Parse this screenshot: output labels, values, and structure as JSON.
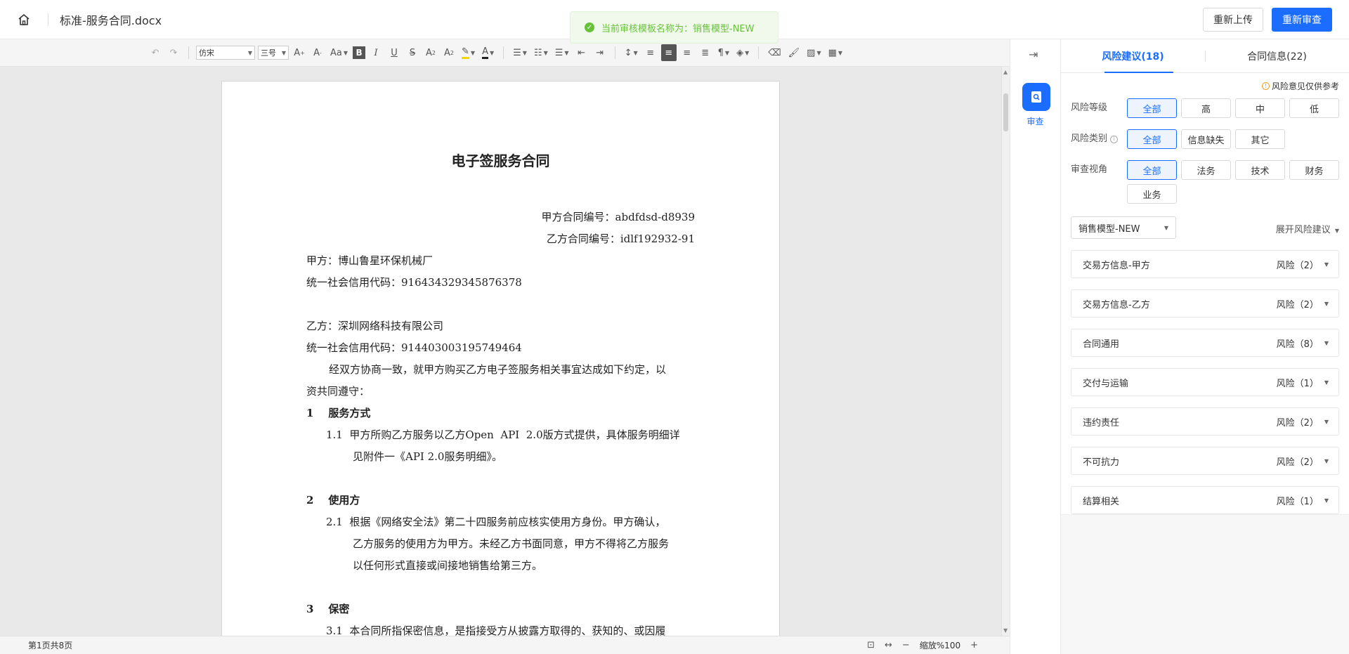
{
  "header": {
    "title": "标准-服务合同.docx",
    "reupload_label": "重新上传",
    "recheck_label": "重新审查"
  },
  "toast": {
    "text": "当前审核模板名称为：销售模型-NEW"
  },
  "toolbar": {
    "font": "仿宋",
    "size": "三号",
    "case_label": "Aa",
    "bold": "B",
    "italic": "I",
    "underline": "U",
    "strike": "S"
  },
  "document": {
    "title": "电子签服务合同",
    "lines": [
      "甲方合同编号：abdfdsd-d8939",
      "乙方合同编号：idlf192932-91",
      "甲方：博山鲁星环保机械厂",
      "统一社会信用代码：916434329345876378",
      "乙方：深圳网络科技有限公司",
      "统一社会信用代码：914403003195749464",
      "经双方协商一致，就甲方购买乙方电子签服务相关事宜达成如下约定，以",
      "资共同遵守：",
      "1    服务方式",
      "1.1  甲方所购乙方服务以乙方Open  API  2.0版方式提供，具体服务明细详",
      "见附件一《API 2.0服务明细》。",
      "2    使用方",
      "2.1  根据《网络安全法》第二十四服务前应核实使用方身份。甲方确认，",
      "乙方服务的使用方为甲方。未经乙方书面同意，甲方不得将乙方服务",
      "以任何形式直接或间接地销售给第三方。",
      "3    保密",
      "3.1  本合同所指保密信息，是指接受方从披露方取得的、获知的、或因履"
    ]
  },
  "statusbar": {
    "page_info": "第1页共8页",
    "zoom": "缩放%100"
  },
  "rail": {
    "review_label": "审查"
  },
  "panel": {
    "tabs": [
      "风险建议(18)",
      "合同信息(22)"
    ],
    "notice": "风险意见仅供参考",
    "filters": [
      {
        "label": "风险等级",
        "options": [
          "全部",
          "高",
          "中",
          "低"
        ]
      },
      {
        "label": "风险类别",
        "options": [
          "全部",
          "信息缺失",
          "其它"
        ]
      },
      {
        "label": "审查视角",
        "options": [
          "全部",
          "法务",
          "技术",
          "财务",
          "业务"
        ]
      }
    ],
    "model_select": "销售模型-NEW",
    "expand_label": "展开风险建议",
    "risk_items": [
      {
        "name": "交易方信息-甲方",
        "count": "风险（2）"
      },
      {
        "name": "交易方信息-乙方",
        "count": "风险（2）"
      },
      {
        "name": "合同通用",
        "count": "风险（8）"
      },
      {
        "name": "交付与运输",
        "count": "风险（1）"
      },
      {
        "name": "违约责任",
        "count": "风险（2）"
      },
      {
        "name": "不可抗力",
        "count": "风险（2）"
      },
      {
        "name": "结算相关",
        "count": "风险（1）"
      }
    ]
  },
  "colors": {
    "accent": "#1a6dff",
    "success": "#67c23a"
  }
}
